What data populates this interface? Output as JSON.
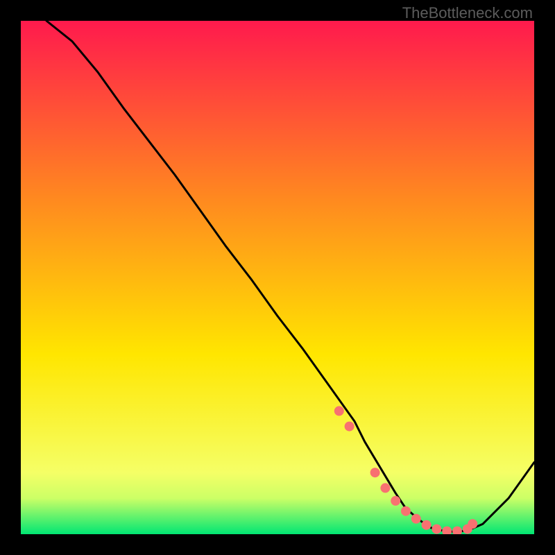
{
  "watermark": "TheBottleneck.com",
  "chart_data": {
    "type": "line",
    "title": "",
    "xlabel": "",
    "ylabel": "",
    "xlim": [
      0,
      100
    ],
    "ylim": [
      0,
      100
    ],
    "grid": false,
    "legend": false,
    "background_gradient": {
      "top": "#ff1a4d",
      "mid": "#ffe600",
      "bottom_band": "#00e673"
    },
    "series": [
      {
        "name": "curve",
        "x": [
          5,
          10,
          15,
          20,
          25,
          30,
          35,
          40,
          45,
          50,
          55,
          60,
          65,
          67,
          70,
          73,
          75,
          78,
          80,
          83,
          85,
          87,
          90,
          95,
          100
        ],
        "y": [
          100,
          96,
          90,
          83,
          76.5,
          70,
          63,
          56,
          49.5,
          42.5,
          36,
          29,
          22,
          18,
          13,
          8,
          5,
          2.5,
          1.2,
          0.5,
          0.5,
          0.7,
          2,
          7,
          14
        ],
        "color": "#000000"
      }
    ],
    "markers": {
      "name": "highlight-dots",
      "color": "#f87171",
      "x": [
        62,
        64,
        69,
        71,
        73,
        75,
        77,
        79,
        81,
        83,
        85,
        87,
        88
      ],
      "y": [
        24,
        21,
        12,
        9,
        6.5,
        4.5,
        3,
        1.8,
        1,
        0.6,
        0.6,
        1,
        2
      ]
    }
  }
}
